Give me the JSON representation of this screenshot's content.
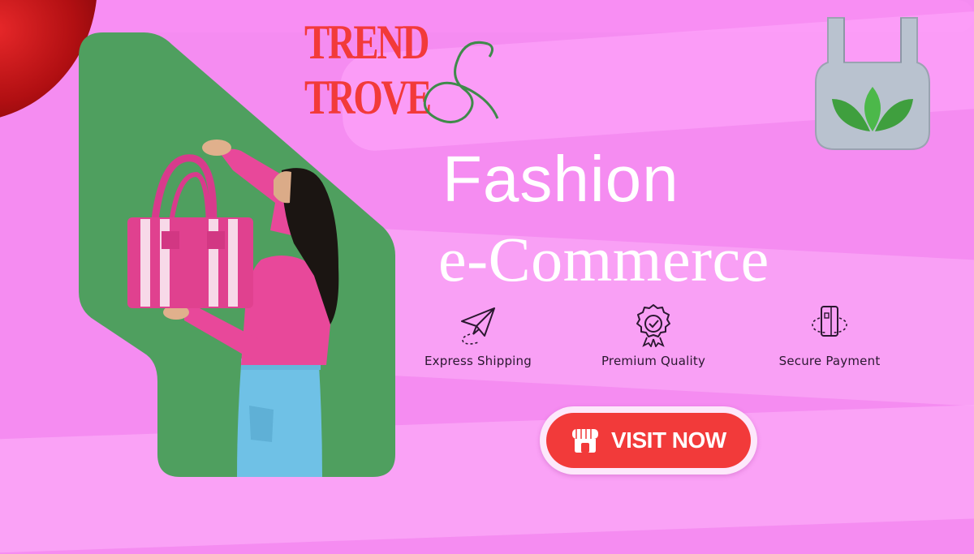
{
  "brand": {
    "line1": "TREND",
    "line2": "TROVE",
    "ampersand": "&",
    "colors": {
      "wordmark": "#f23a3a",
      "ampersand": "#3f8a4a"
    }
  },
  "headline": {
    "line1": "Fashion",
    "line2": "e-Commerce"
  },
  "features": [
    {
      "label": "Express Shipping",
      "icon": "paper-plane-icon"
    },
    {
      "label": "Premium Quality",
      "icon": "quality-badge-icon"
    },
    {
      "label": "Secure Payment",
      "icon": "card-rotate-icon"
    }
  ],
  "cta": {
    "label": "VISIT NOW",
    "icon": "storefront-icon",
    "color": "#f23a3a"
  },
  "decor": {
    "eco_bag": "eco-shopping-bag-icon",
    "curtain": "red-curtain",
    "photo": "woman-holding-pink-striped-tote-bag"
  },
  "colors": {
    "background": "#f58cf1",
    "photo_bg": "#4f9f5f",
    "text_light": "#ffffff",
    "text_dark": "#2b1830"
  }
}
